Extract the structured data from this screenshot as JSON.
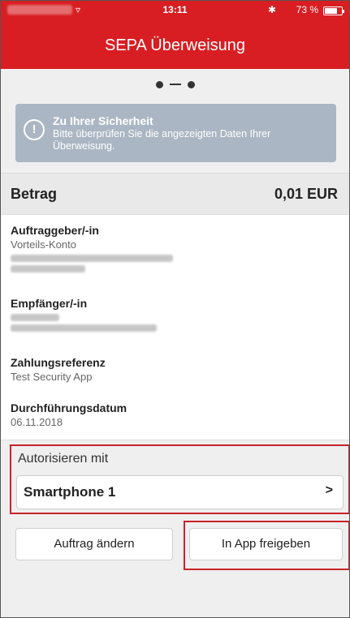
{
  "status_bar": {
    "time": "13:11",
    "bluetooth_icon": "bluetooth-icon",
    "battery_percent": "73 %",
    "battery_level": 0.73
  },
  "header": {
    "title": "SEPA Überweisung"
  },
  "steps": {
    "total": 2
  },
  "info": {
    "icon": "exclamation-circle-icon",
    "title": "Zu Ihrer Sicherheit",
    "text": "Bitte überprüfen Sie die angezeigten Daten Ihrer Überweisung."
  },
  "amount": {
    "label": "Betrag",
    "value": "0,01 EUR"
  },
  "details": {
    "sender": {
      "label": "Auftraggeber/-in",
      "value": "Vorteils-Konto"
    },
    "recipient": {
      "label": "Empfänger/-in"
    },
    "reference": {
      "label": "Zahlungsreferenz",
      "value": "Test Security App"
    },
    "execution_date": {
      "label": "Durchführungsdatum",
      "value": "06.11.2018"
    }
  },
  "authorize": {
    "label": "Autorisieren mit",
    "device": "Smartphone 1",
    "chevron_icon": "chevron-right-icon"
  },
  "buttons": {
    "change": "Auftrag ändern",
    "release": "In App freigeben"
  },
  "colors": {
    "brand_red": "#d81e22",
    "info_bg": "#aab6c3",
    "highlight_border": "#c9222a"
  }
}
